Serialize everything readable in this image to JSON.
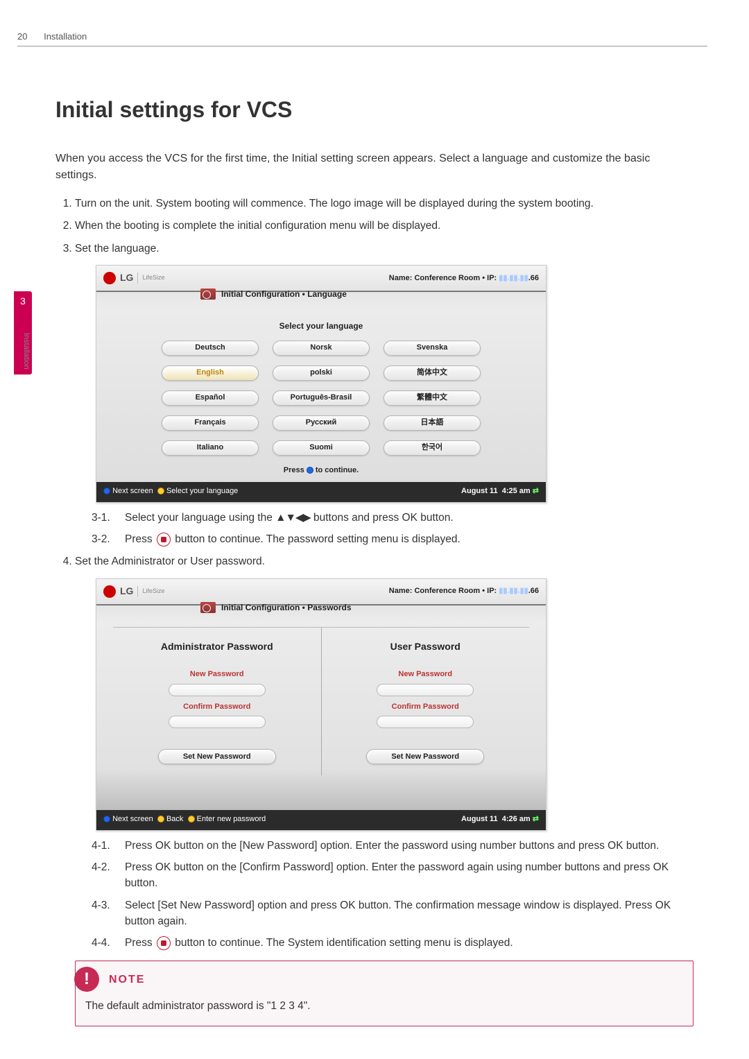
{
  "page": {
    "number": "20",
    "section": "Installation"
  },
  "side": {
    "chapter_num": "3",
    "chapter_label": "Installation"
  },
  "title": "Initial settings for VCS",
  "intro": "When you access the VCS for the first time, the Initial setting screen appears. Select a language and customize the basic settings.",
  "steps": [
    "Turn on the unit. System booting will commence. The logo image will be displayed during the system booting.",
    "When the booting is complete the initial configuration menu will be displayed.",
    "Set the language."
  ],
  "screenshot_lang": {
    "logo_brand": "LG",
    "logo_sub": "LifeSize",
    "room_label": "Name: Conference Room • IP:",
    "ip_tail": ".66",
    "breadcrumb": "Initial Configuration • Language",
    "subtitle": "Select your language",
    "languages": [
      "Deutsch",
      "Norsk",
      "Svenska",
      "English",
      "polski",
      "简体中文",
      "Español",
      "Português-Brasil",
      "繁體中文",
      "Français",
      "Русский",
      "日本語",
      "Italiano",
      "Suomi",
      "한국어"
    ],
    "selected": "English",
    "press_prefix": "Press ",
    "press_suffix": " to continue.",
    "footer_left_a": "Next screen",
    "footer_left_b": "Select your language",
    "footer_date": "August 11",
    "footer_time": "4:25 am"
  },
  "sub_steps_3": [
    {
      "n": "3-1.",
      "text_before": "Select your language using the ",
      "arrows": "▲▼◀▶",
      "text_after": " buttons and press OK button."
    },
    {
      "n": "3-2.",
      "text_before": "Press ",
      "has_icon": true,
      "text_after": " button to continue. The password setting menu is displayed."
    }
  ],
  "step4": "Set the Administrator or User password.",
  "screenshot_pw": {
    "breadcrumb": "Initial Configuration • Passwords",
    "col_a_head": "Administrator Password",
    "col_b_head": "User Password",
    "label_new": "New Password",
    "label_confirm": "Confirm Password",
    "set_btn": "Set New Password",
    "footer_left_a": "Next screen",
    "footer_left_b": "Back",
    "footer_left_c": "Enter new password",
    "footer_date": "August 11",
    "footer_time": "4:26 am"
  },
  "sub_steps_4": [
    {
      "n": "4-1.",
      "text": "Press OK button on the [New Password] option. Enter the password using number buttons and press OK button."
    },
    {
      "n": "4-2.",
      "text": "Press OK button on the [Confirm Password] option. Enter the password again using number buttons and press OK button."
    },
    {
      "n": "4-3.",
      "text": "Select [Set New Password] option and press OK button. The confirmation message window is displayed. Press OK button again."
    },
    {
      "n": "4-4.",
      "text_before": "Press ",
      "has_icon": true,
      "text_after": " button to continue. The System identification setting menu is displayed."
    }
  ],
  "note": {
    "title": "NOTE",
    "body": "The default administrator password is \"1 2 3 4\"."
  }
}
